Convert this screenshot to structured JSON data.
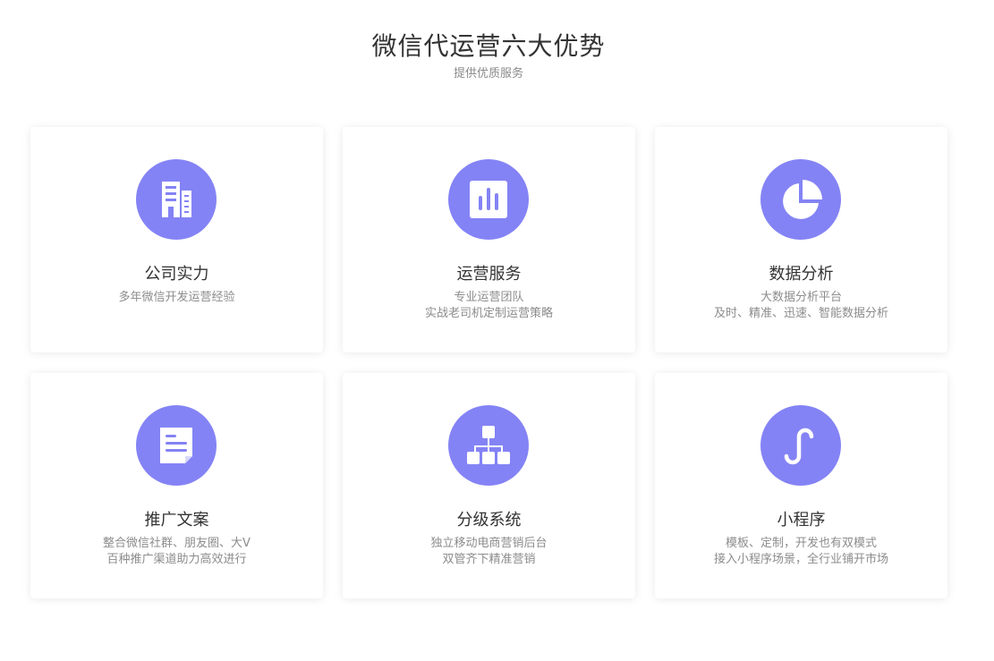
{
  "header": {
    "title": "微信代运营六大优势",
    "subtitle": "提供优质服务"
  },
  "theme": {
    "accent": "#8483f5",
    "card_bg": "#ffffff",
    "title_color": "#333333",
    "desc_color": "#8c8c8c"
  },
  "cards": [
    {
      "icon": "building-icon",
      "title": "公司实力",
      "lines": [
        "多年微信开发运营经验",
        ""
      ]
    },
    {
      "icon": "bar-chart-icon",
      "title": "运营服务",
      "lines": [
        "专业运营团队",
        "实战老司机定制运营策略"
      ]
    },
    {
      "icon": "pie-chart-icon",
      "title": "数据分析",
      "lines": [
        "大数据分析平台",
        "及时、精准、迅速、智能数据分析"
      ]
    },
    {
      "icon": "document-icon",
      "title": "推广文案",
      "lines": [
        "整合微信社群、朋友圈、大V",
        "百种推广渠道助力高效进行"
      ]
    },
    {
      "icon": "hierarchy-icon",
      "title": "分级系统",
      "lines": [
        "独立移动电商营销后台",
        "双管齐下精准营销"
      ]
    },
    {
      "icon": "mini-program-icon",
      "title": "小程序",
      "lines": [
        "模板、定制，开发也有双模式",
        "接入小程序场景，全行业铺开市场"
      ]
    }
  ]
}
